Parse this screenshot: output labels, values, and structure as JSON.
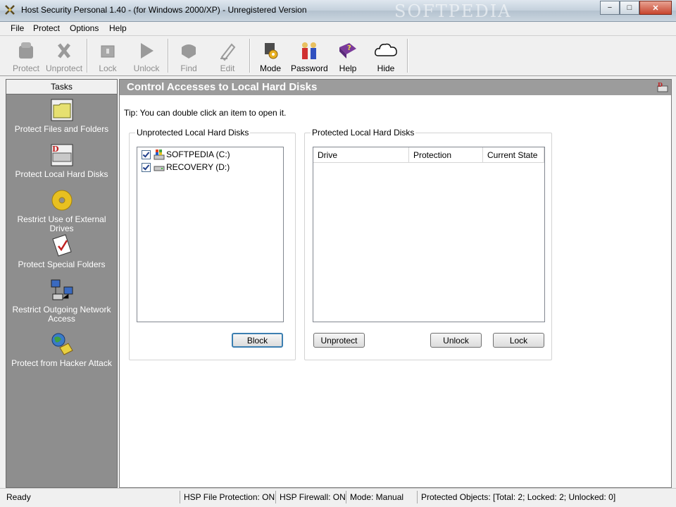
{
  "window": {
    "title": "Host Security Personal 1.40 - (for Windows 2000/XP) - Unregistered Version",
    "watermark": "SOFTPEDIA",
    "controls": {
      "minimize": "−",
      "maximize": "□",
      "close": "✕"
    }
  },
  "menu": [
    "File",
    "Protect",
    "Options",
    "Help"
  ],
  "toolbar": {
    "protect": "Protect",
    "unprotect": "Unprotect",
    "lock": "Lock",
    "unlock": "Unlock",
    "find": "Find",
    "edit": "Edit",
    "mode": "Mode",
    "password": "Password",
    "help": "Help",
    "hide": "Hide"
  },
  "sidebar": {
    "header": "Tasks",
    "items": [
      {
        "label": "Protect Files and Folders",
        "icon": "folder-icon"
      },
      {
        "label": "Protect Local Hard Disks",
        "icon": "hard-disk-icon"
      },
      {
        "label": "Restrict Use of External Drives",
        "icon": "cd-icon"
      },
      {
        "label": "Protect Special Folders",
        "icon": "checklist-icon"
      },
      {
        "label": "Restrict Outgoing Network Access",
        "icon": "network-icon"
      },
      {
        "label": "Protect from Hacker Attack",
        "icon": "globe-lock-icon"
      }
    ]
  },
  "main": {
    "heading": "Control Accesses to Local Hard Disks",
    "tip": "Tip:  You can double click an item to open it.",
    "unprotected": {
      "title": "Unprotected Local Hard Disks",
      "drives": [
        "SOFTPEDIA (C:)",
        "RECOVERY (D:)"
      ],
      "block_button": "Block"
    },
    "protected": {
      "title": "Protected Local Hard Disks",
      "columns": [
        "Drive",
        "Protection",
        "Current State"
      ],
      "unprotect_button": "Unprotect",
      "unlock_button": "Unlock",
      "lock_button": "Lock"
    }
  },
  "status": {
    "ready": "Ready",
    "file_protection": "HSP File Protection: ON",
    "firewall": "HSP Firewall: ON",
    "mode": "Mode: Manual",
    "objects": "Protected Objects: [Total: 2; Locked: 2; Unlocked: 0]"
  },
  "colors": {
    "sidebar_bg": "#8e8e8e",
    "header_bg": "#9c9c9c",
    "accent": "#3c7fb1"
  }
}
